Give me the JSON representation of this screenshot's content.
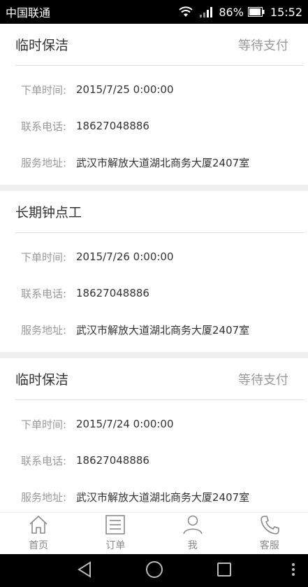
{
  "status_bar": {
    "carrier": "中国联通",
    "battery": "86%",
    "time": "15:52"
  },
  "orders": [
    {
      "service_type": "临时保洁",
      "status": "等待支付",
      "rows": [
        {
          "label": "下单时间:",
          "value": "2015/7/25 0:00:00"
        },
        {
          "label": "联系电话:",
          "value": "18627048886"
        },
        {
          "label": "服务地址:",
          "value": "武汉市解放大道湖北商务大厦2407室"
        }
      ]
    },
    {
      "service_type": "长期钟点工",
      "status": "",
      "rows": [
        {
          "label": "下单时间:",
          "value": "2015/7/26 0:00:00"
        },
        {
          "label": "联系电话:",
          "value": "18627048886"
        },
        {
          "label": "服务地址:",
          "value": "武汉市解放大道湖北商务大厦2407室"
        }
      ]
    },
    {
      "service_type": "临时保洁",
      "status": "等待支付",
      "rows": [
        {
          "label": "下单时间:",
          "value": "2015/7/24 0:00:00"
        },
        {
          "label": "联系电话:",
          "value": "18627048886"
        },
        {
          "label": "服务地址:",
          "value": "武汉市解放大道湖北商务大厦2407室"
        }
      ]
    }
  ],
  "tab_bar": {
    "tabs": [
      {
        "label": "首页",
        "icon": "home-icon"
      },
      {
        "label": "订单",
        "icon": "order-list-icon"
      },
      {
        "label": "我",
        "icon": "person-icon"
      },
      {
        "label": "客服",
        "icon": "phone-icon"
      }
    ]
  },
  "colors": {
    "text_primary": "#333333",
    "text_secondary": "#999999",
    "separator": "#f0f0f0",
    "tab_icon": "#8a8a8a"
  }
}
